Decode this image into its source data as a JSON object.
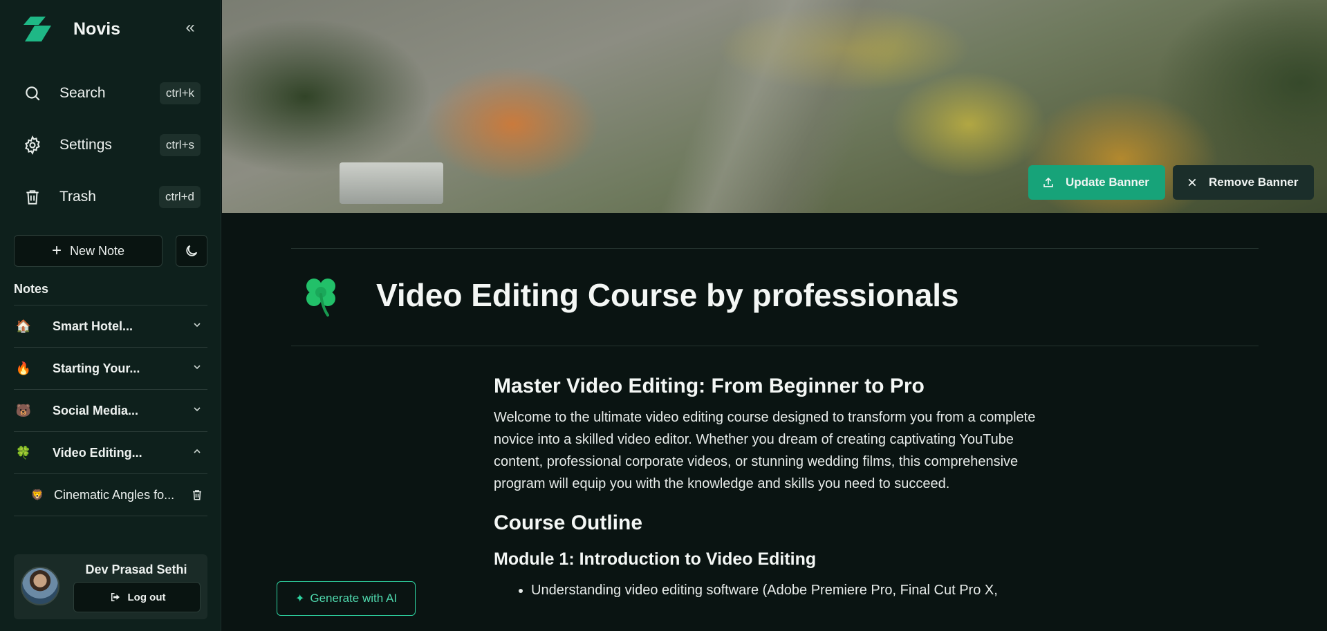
{
  "app": {
    "name": "Novis"
  },
  "sidebar": {
    "menu": [
      {
        "label": "Search",
        "shortcut": "ctrl+k",
        "icon": "search-icon"
      },
      {
        "label": "Settings",
        "shortcut": "ctrl+s",
        "icon": "gear-icon"
      },
      {
        "label": "Trash",
        "shortcut": "ctrl+d",
        "icon": "trash-icon"
      }
    ],
    "new_note_label": "New Note",
    "notes_heading": "Notes",
    "notes": [
      {
        "emoji": "🏠",
        "label": "Smart Hotel...",
        "expanded": false
      },
      {
        "emoji": "🔥",
        "label": "Starting Your...",
        "expanded": false
      },
      {
        "emoji": "🐻",
        "label": "Social Media...",
        "expanded": false
      },
      {
        "emoji": "🍀",
        "label": "Video Editing...",
        "expanded": true
      }
    ],
    "child_note": {
      "emoji": "🦁",
      "label": "Cinematic Angles fo..."
    },
    "user": {
      "name": "Dev Prasad Sethi",
      "logout_label": "Log out"
    }
  },
  "banner": {
    "update_label": "Update Banner",
    "remove_label": "Remove Banner"
  },
  "page": {
    "emoji": "🍀",
    "title": "Video Editing Course by professionals"
  },
  "document": {
    "heading": "Master Video Editing: From Beginner to Pro",
    "intro": "Welcome to the ultimate video editing course designed to transform you from a complete novice into a skilled video editor. Whether you dream of creating captivating YouTube content, professional corporate videos, or stunning wedding films, this comprehensive program will equip you with the knowledge and skills you need to succeed.",
    "outline_heading": "Course Outline",
    "module1_heading": "Module 1: Introduction to Video Editing",
    "module1_items": [
      "Understanding video editing software (Adobe Premiere Pro, Final Cut Pro X,"
    ]
  },
  "ai": {
    "generate_label": "Generate with AI"
  },
  "colors": {
    "accent": "#17a379",
    "sidebar_bg": "#0e201c",
    "page_bg": "#0a1412",
    "ai_border": "#2ed3a0"
  }
}
